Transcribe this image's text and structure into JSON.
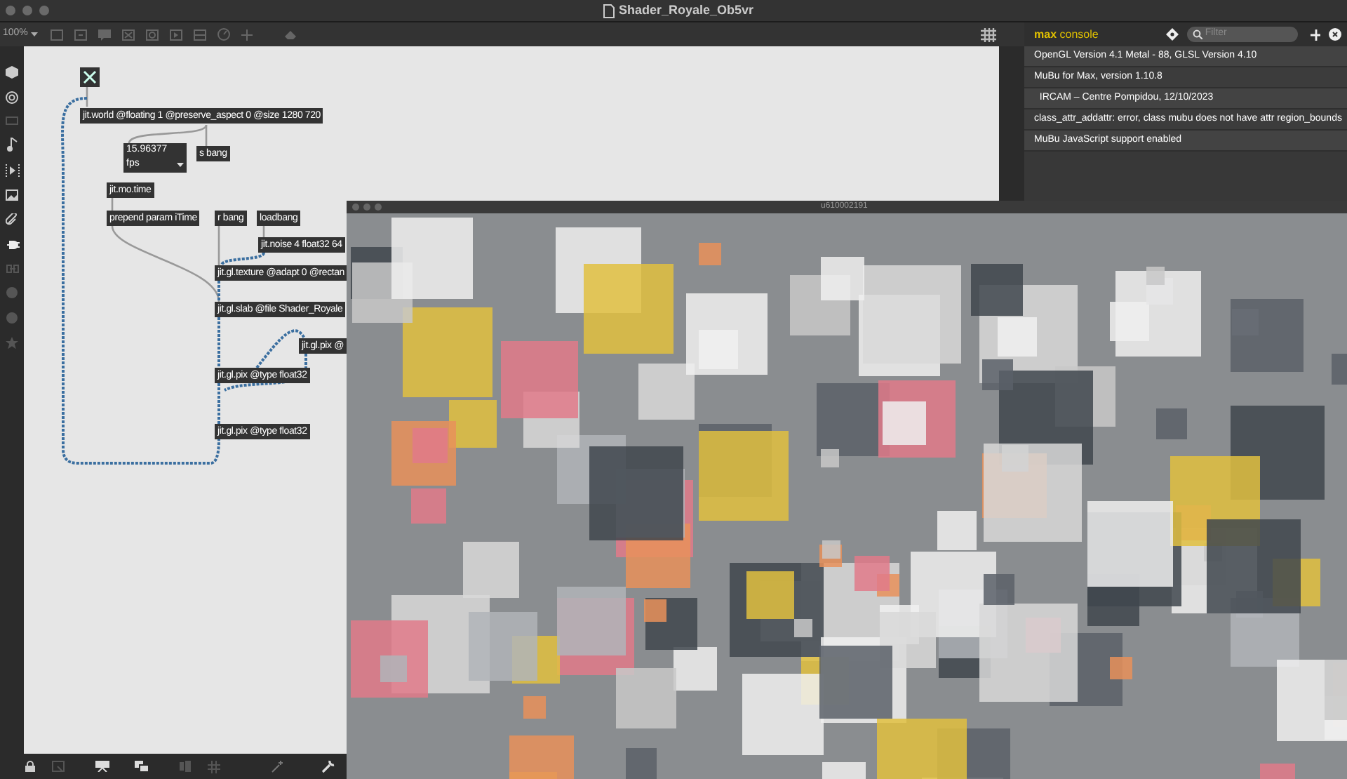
{
  "window": {
    "title": "Shader_Royale_Ob5vr"
  },
  "toolbar": {
    "zoom": "100%"
  },
  "patch": {
    "toggle": {
      "checked": true
    },
    "objects": [
      {
        "kind": "object",
        "text": "jit.world @floating 1 @preserve_aspect 0 @size 1280 720"
      },
      {
        "kind": "number",
        "text": "15.96377",
        "unit": "fps"
      },
      {
        "kind": "object",
        "text": "s bang"
      },
      {
        "kind": "object",
        "text": "jit.mo.time"
      },
      {
        "kind": "object",
        "text": "prepend param iTime"
      },
      {
        "kind": "object",
        "text": "r bang"
      },
      {
        "kind": "object",
        "text": "loadbang"
      },
      {
        "kind": "object",
        "text": "jit.noise 4 float32 64"
      },
      {
        "kind": "object",
        "text": "jit.gl.texture @adapt 0 @rectan"
      },
      {
        "kind": "object",
        "text": "jit.gl.slab @file Shader_Royale"
      },
      {
        "kind": "object",
        "text": "jit.gl.pix @"
      },
      {
        "kind": "object",
        "text": "jit.gl.pix @type float32"
      },
      {
        "kind": "object",
        "text": "jit.gl.pix @type float32"
      }
    ]
  },
  "console": {
    "title_bold": "max",
    "title": "console",
    "filter_placeholder": "Filter",
    "lines": [
      "OpenGL Version 4.1 Metal - 88, GLSL Version 4.10",
      "MuBu for Max, version 1.10.8",
      "  IRCAM – Centre Pompidou, 12/10/2023",
      "class_attr_addattr: error, class mubu does not have attr region_bounds",
      "MuBu JavaScript support enabled"
    ]
  },
  "render_window": {
    "title": "u610002191"
  }
}
